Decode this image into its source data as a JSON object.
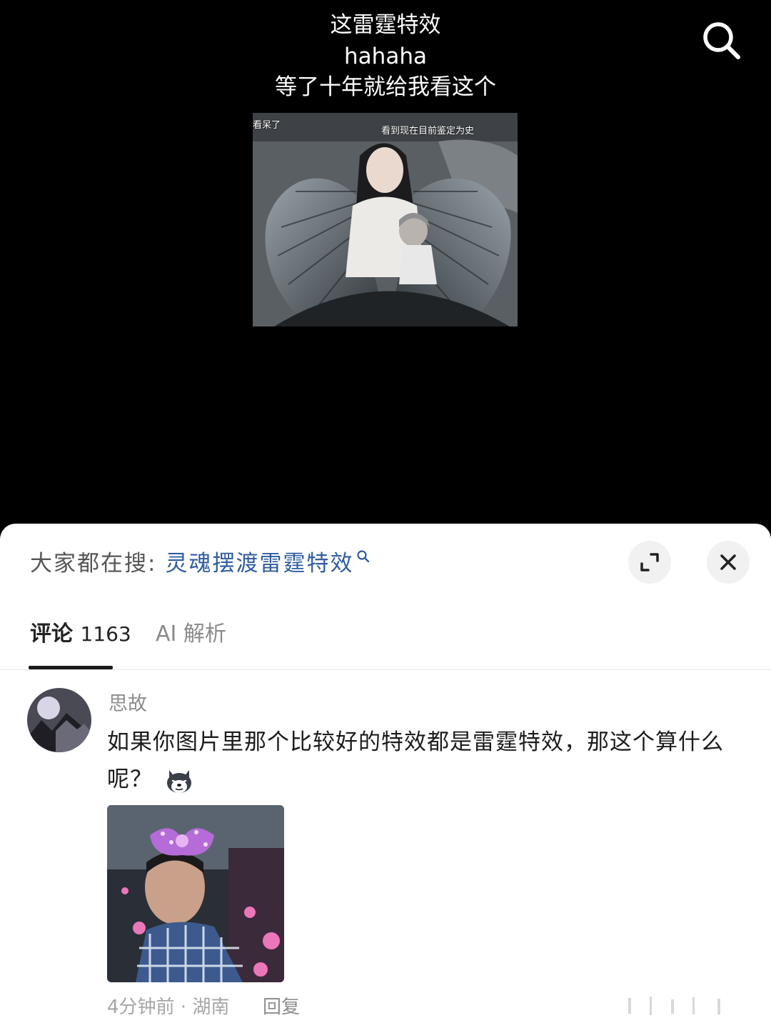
{
  "video": {
    "caption_lines": [
      "这雷霆特效",
      "hahaha",
      "等了十年就给我看这个"
    ],
    "frame_subtitle_left": "看呆了",
    "frame_subtitle_right": "看到现在目前鉴定为史",
    "search_icon": "search-icon"
  },
  "comments_panel": {
    "trending_label": "大家都在搜:",
    "trending_query": "灵魂摆渡雷霆特效",
    "trending_icon": "search-icon",
    "expand_icon": "expand-icon",
    "close_icon": "close-icon",
    "tabs": [
      {
        "label": "评论",
        "count": "1163"
      },
      {
        "label": "AI 解析"
      }
    ],
    "comment": {
      "username": "思故",
      "text": "如果你图片里那个比较好的特效都是雷霆特效，那这个算什么呢？",
      "emoji": "husky-emoji",
      "time_location": "4分钟前 · 湖南",
      "reply_label": "回复"
    }
  },
  "colors": {
    "video_bg": "#000000",
    "sheet_bg": "#ffffff",
    "trending_query": "#2f5d9e",
    "muted_text": "#8e8e8e"
  }
}
